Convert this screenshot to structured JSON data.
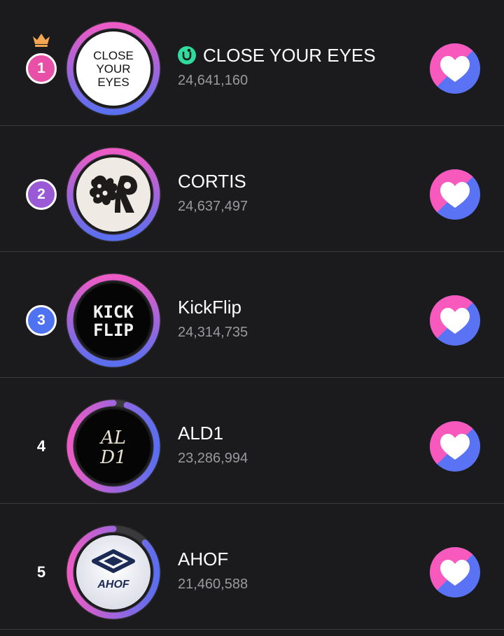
{
  "colors": {
    "background": "#1b1b1d",
    "divider": "#3a3a3d",
    "ring_pink": "#ec5bc6",
    "ring_blue": "#5a6ff0",
    "rank1": "#e84fa6",
    "rank2": "#9a5ad6",
    "rank3": "#4f73f0",
    "vote_pink": "#f759bd",
    "vote_blue": "#5a73f4",
    "verified_green": "#2fdc9e"
  },
  "ranking": [
    {
      "rank": "1",
      "name": "CLOSE YOUR EYES",
      "votes": "24,641,160",
      "logo_text": [
        "CLOSE",
        "YOUR",
        "EYES"
      ],
      "verified": true,
      "crown": true,
      "progress": 1.0
    },
    {
      "rank": "2",
      "name": "CORTIS",
      "votes": "24,637,497",
      "logo_text": [],
      "verified": false,
      "crown": false,
      "progress": 1.0
    },
    {
      "rank": "3",
      "name": "KickFlip",
      "votes": "24,314,735",
      "logo_text": [
        "KICK",
        "FLIP"
      ],
      "verified": false,
      "crown": false,
      "progress": 1.0
    },
    {
      "rank": "4",
      "name": "ALD1",
      "votes": "23,286,994",
      "logo_text": [
        "AL",
        "D1"
      ],
      "verified": false,
      "crown": false,
      "progress": 0.95
    },
    {
      "rank": "5",
      "name": "AHOF",
      "votes": "21,460,588",
      "logo_text": [
        "AHOF"
      ],
      "verified": false,
      "crown": false,
      "progress": 0.87
    }
  ],
  "icons": {
    "crown": "crown-icon",
    "verified": "verified-icon",
    "vote": "heart-icon"
  }
}
